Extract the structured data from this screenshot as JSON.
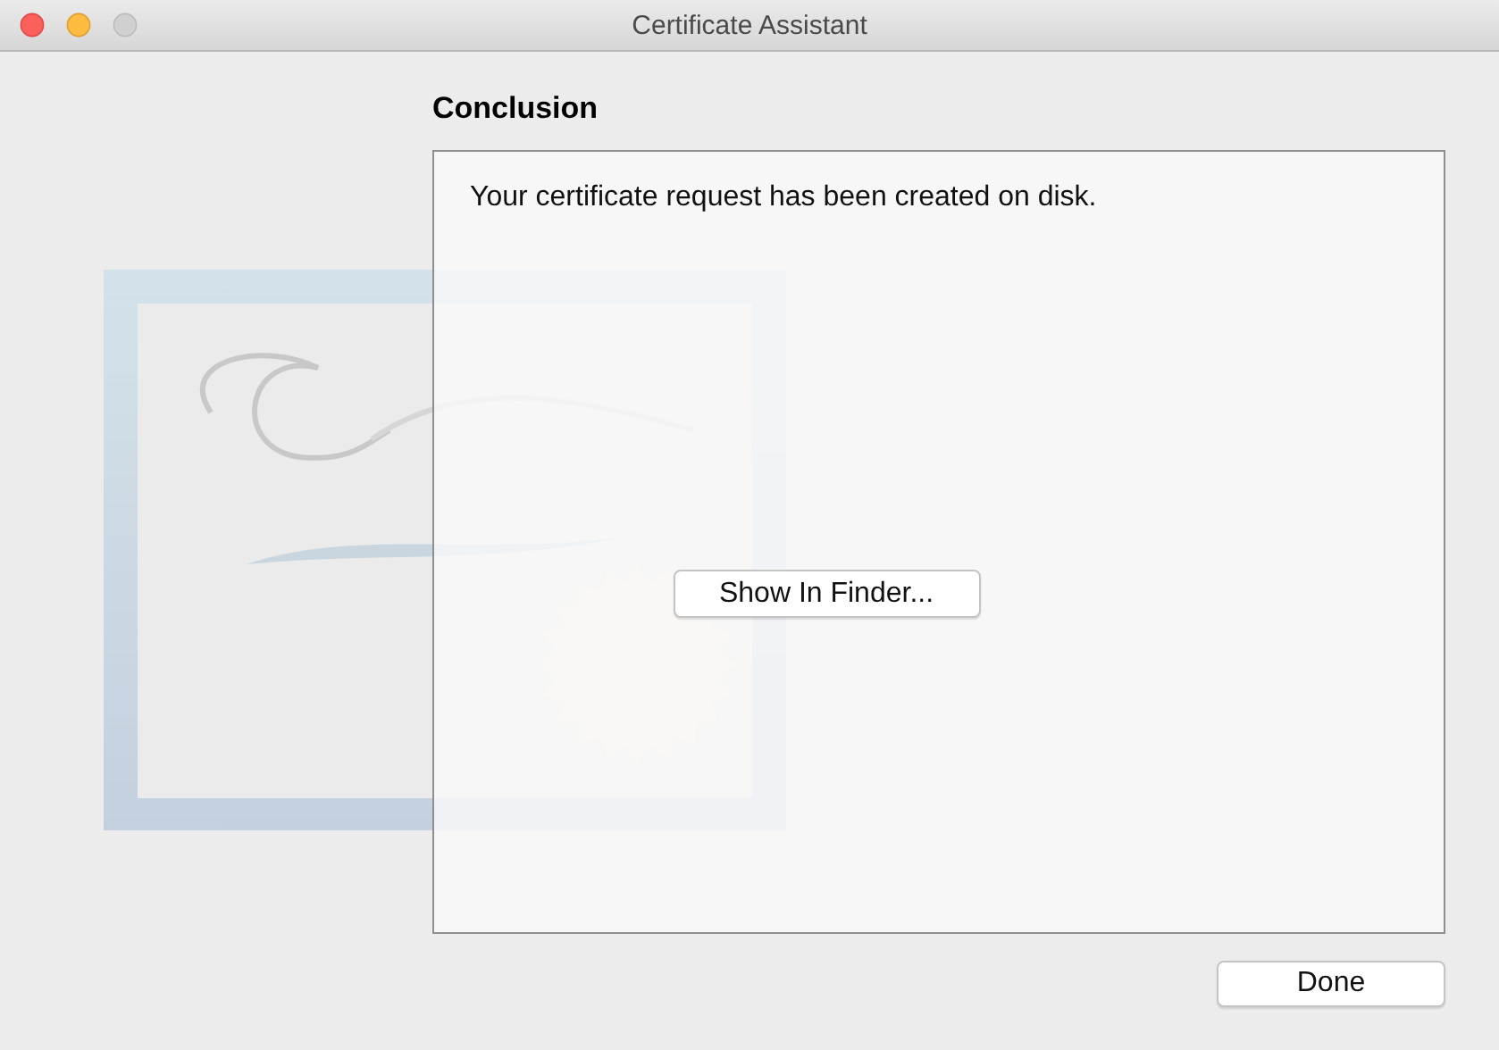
{
  "window": {
    "title": "Certificate Assistant",
    "controls": [
      {
        "kind": "close",
        "disabled": false
      },
      {
        "kind": "minimize",
        "disabled": false
      },
      {
        "kind": "zoom",
        "disabled": true
      }
    ]
  },
  "section": {
    "heading": "Conclusion",
    "message": "Your certificate request has been created on disk.",
    "action": "Show In Finder..."
  },
  "buttons": [
    "Done"
  ]
}
